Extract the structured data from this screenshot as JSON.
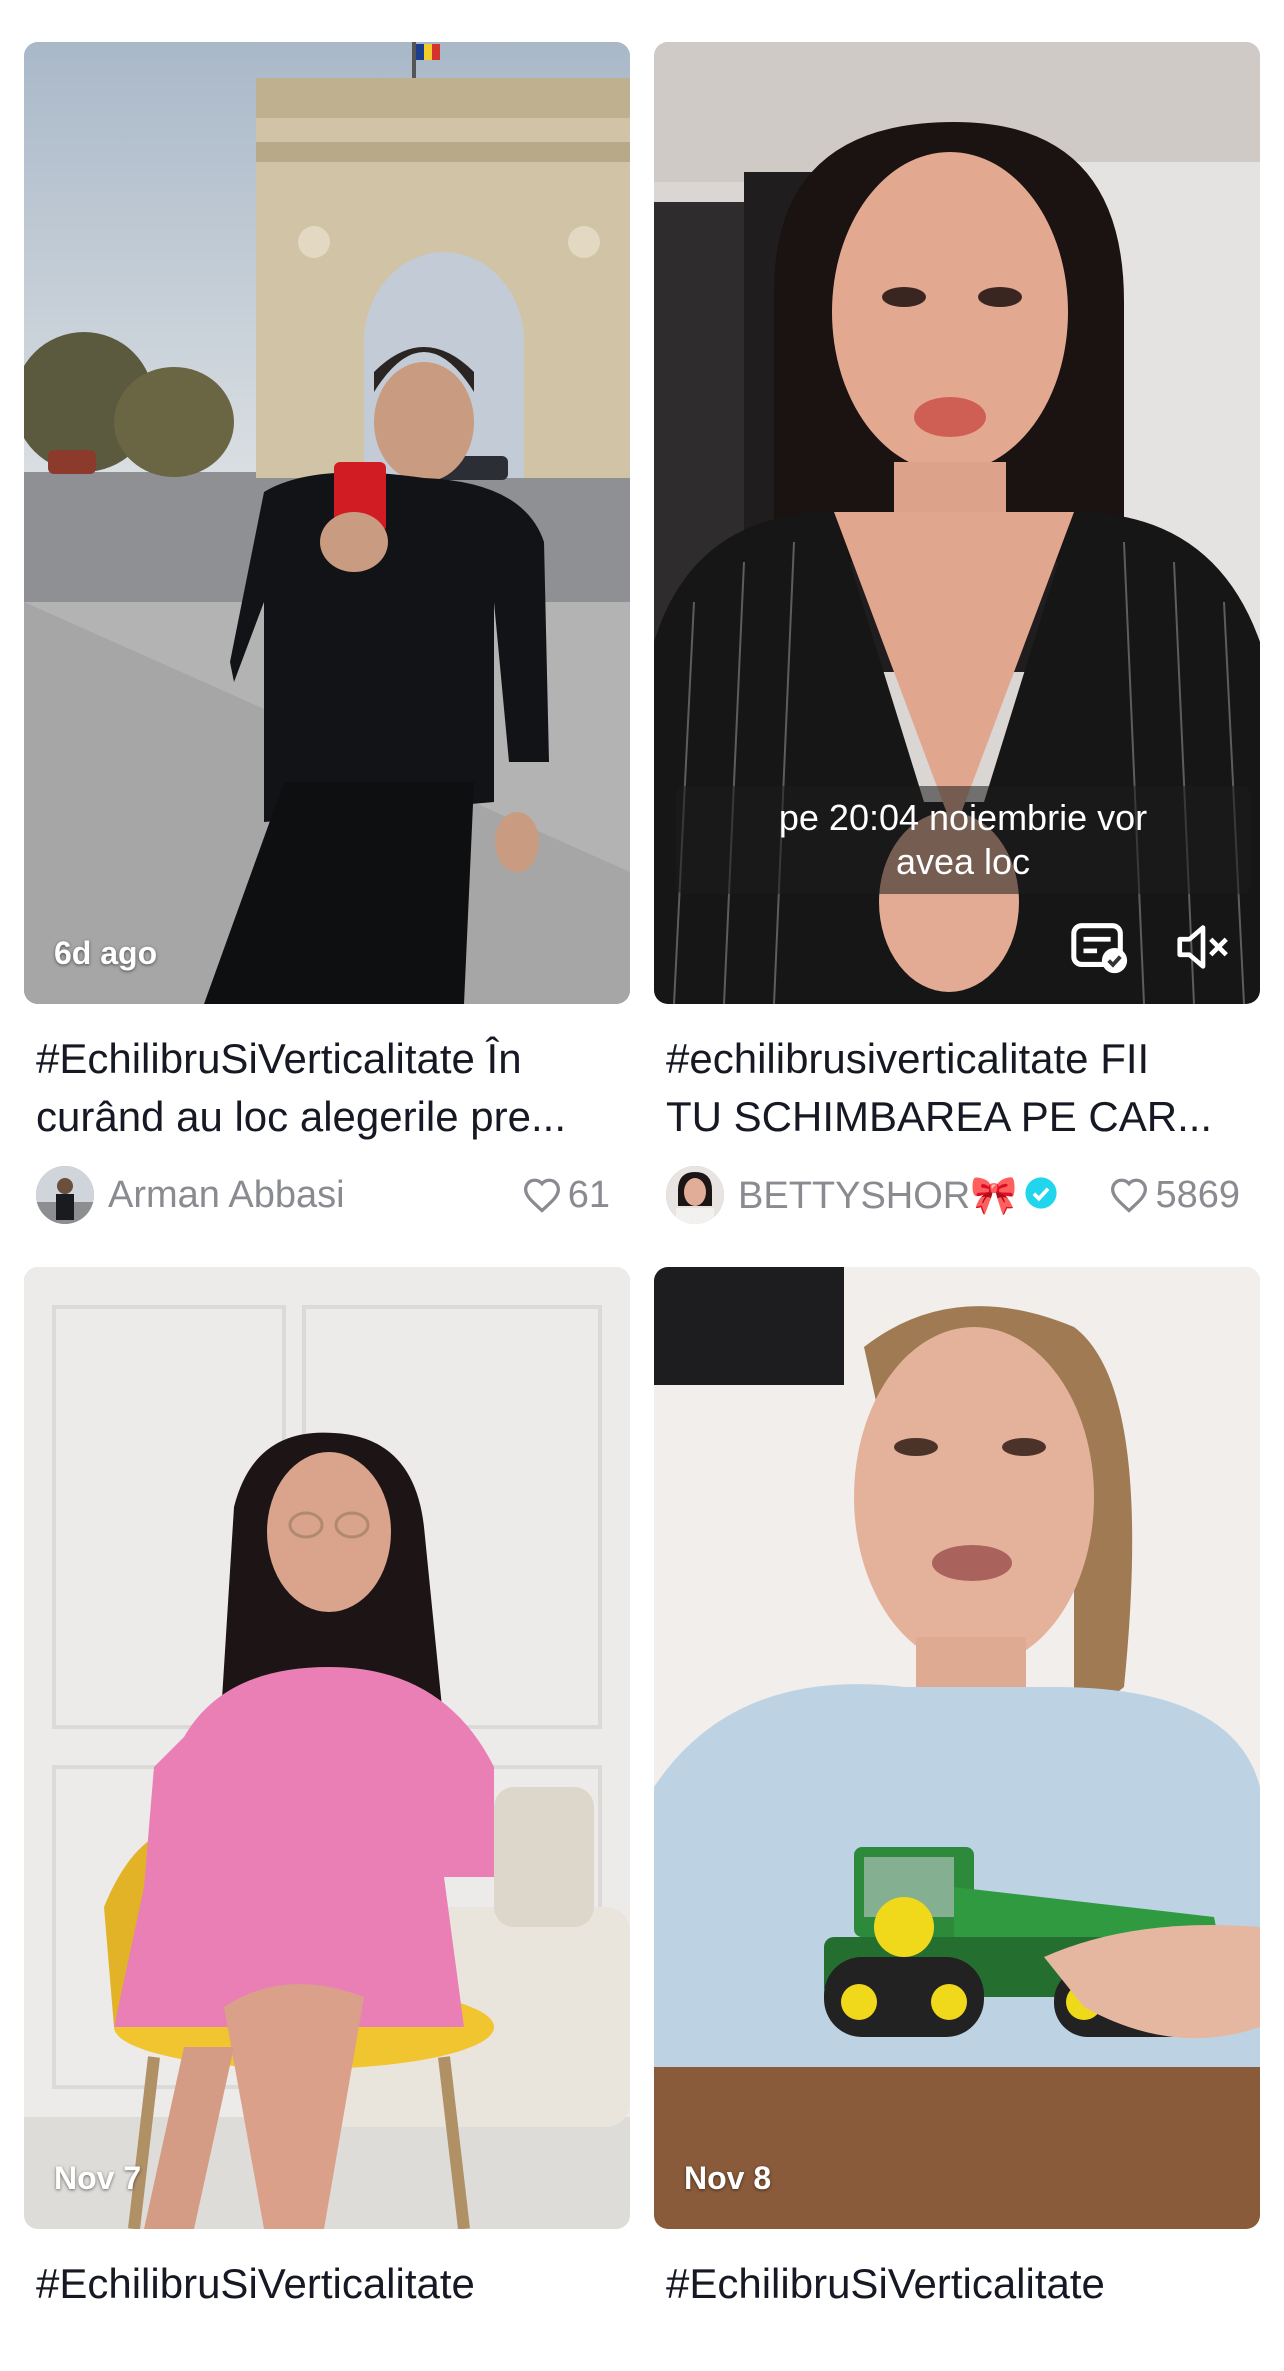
{
  "videos": [
    {
      "date": "6d ago",
      "title_line1": "#EchilibruSiVerticalitate În",
      "title_line2": "curând au loc alegerile pre...",
      "author": "Arman Abbasi",
      "likes": "61",
      "icons": [
        "heart-icon"
      ]
    },
    {
      "overlay_caption_line1": "pe 20:04 noiembrie vor",
      "overlay_caption_line2": "avea loc",
      "title_line1": "#echilibrusiverticalitate FII",
      "title_line2": "TU SCHIMBAREA PE CAR...",
      "author": "BETTYSHOR🎀",
      "verified": true,
      "likes": "5869",
      "icons": [
        "captions-icon",
        "mute-icon",
        "verified-icon",
        "heart-icon"
      ]
    },
    {
      "date": "Nov 7",
      "title_line1": "#EchilibruSiVerticalitate"
    },
    {
      "date": "Nov 8",
      "title_line1": "#EchilibruSiVerticalitate"
    }
  ],
  "colors": {
    "text_primary": "#161823",
    "text_secondary": "#8a8b91",
    "verified_badge": "#20d5ec",
    "background": "#ffffff"
  }
}
